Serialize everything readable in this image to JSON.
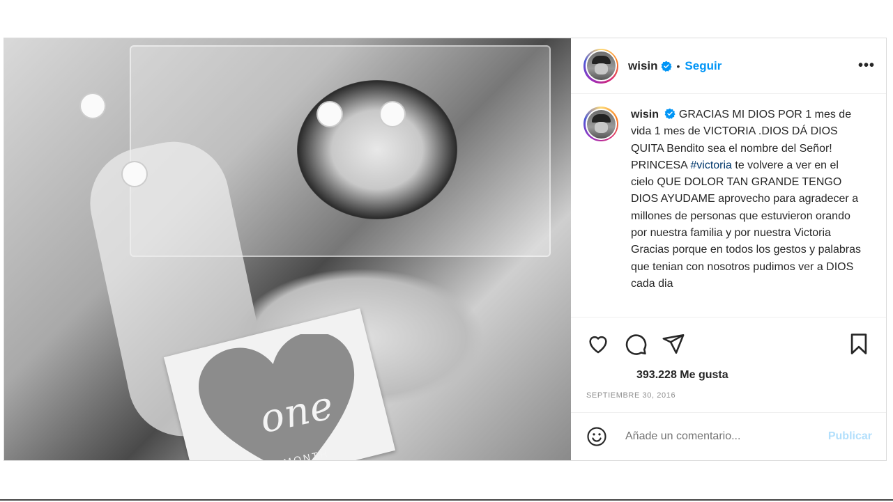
{
  "post": {
    "username": "wisin",
    "follow_label": "Seguir",
    "separator": "•",
    "more_label": "•••",
    "caption_start": "GRACIAS MI DIOS POR 1 mes de vida 1 mes de VICTORIA .DIOS DÁ DIOS QUITA Bendito sea el nombre del Señor! PRINCESA ",
    "caption_hashtag": "#victoria",
    "caption_rest": " te volvere a ver en el cielo QUE DOLOR TAN GRANDE TENGO DIOS AYUDAME aprovecho para agradecer a millones de personas que estuvieron orando por nuestra familia y por nuestra Victoria Gracias porque en todos los gestos y palabras que tenian con nosotros pudimos ver a DIOS cada dia",
    "likes": "393.228 Me gusta",
    "date": "SEPTIEMBRE 30, 2016",
    "image_text": {
      "one": "one",
      "month": "MONTH"
    }
  },
  "comment": {
    "placeholder": "Añade un comentario...",
    "publish_label": "Publicar"
  },
  "icons": {
    "verified": "verified-badge-icon",
    "like": "heart-icon",
    "comment": "comment-icon",
    "share": "paper-plane-icon",
    "save": "bookmark-icon",
    "emoji": "emoji-icon"
  },
  "colors": {
    "link_blue": "#0095f6",
    "hashtag": "#00376b",
    "publish_disabled": "#b2dffc",
    "muted": "#8e8e8e"
  }
}
